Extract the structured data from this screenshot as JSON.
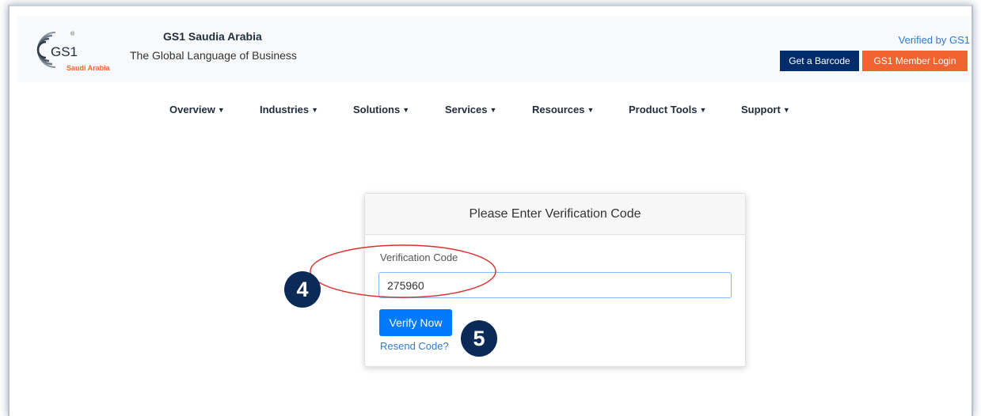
{
  "brand": {
    "logo_text": "GS1",
    "logo_sub": "Saudi Arabia",
    "title": "GS1 Saudia Arabia",
    "tagline": "The Global Language of Business"
  },
  "header": {
    "verified": "Verified by GS1",
    "barcode_btn": "Get a Barcode",
    "login_btn": "GS1 Member Login"
  },
  "nav": {
    "items": [
      {
        "label": "Overview"
      },
      {
        "label": "Industries"
      },
      {
        "label": "Solutions"
      },
      {
        "label": "Services"
      },
      {
        "label": "Resources"
      },
      {
        "label": "Product Tools"
      },
      {
        "label": "Support"
      }
    ],
    "chevron": "❯"
  },
  "card": {
    "title": "Please Enter Verification Code",
    "field_label": "Verification Code",
    "field_value": "275960",
    "verify_btn": "Verify Now",
    "resend_link": "Resend Code?"
  },
  "annotations": {
    "step_4": "4",
    "step_5": "5"
  },
  "colors": {
    "navy": "#002c6c",
    "orange": "#f26334",
    "primary_blue": "#007bff",
    "badge": "#0b2a57",
    "annotation_red": "#d9302c"
  }
}
